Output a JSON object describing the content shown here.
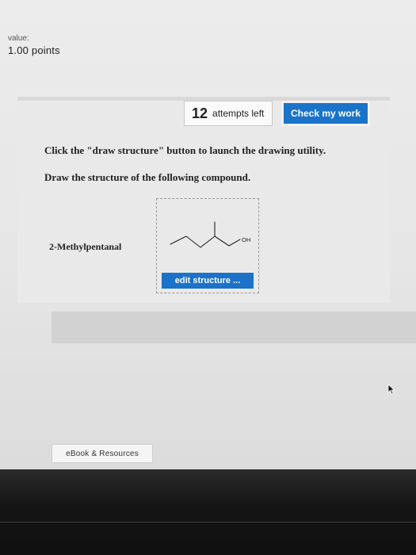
{
  "header": {
    "value_label": "value:",
    "points": "1.00 points"
  },
  "toolbar": {
    "attempts_count": "12",
    "attempts_text": "attempts left",
    "check_label": "Check my work",
    "accent_color": "#1a73c9"
  },
  "question": {
    "instruction_1": "Click the \"draw structure\" button to launch the drawing utility.",
    "instruction_2": "Draw the structure of the following compound.",
    "compound": "2-Methylpentanal",
    "structure_label": "OH",
    "edit_label": "edit structure ..."
  },
  "footer": {
    "ebook_label": "eBook & Resources"
  }
}
